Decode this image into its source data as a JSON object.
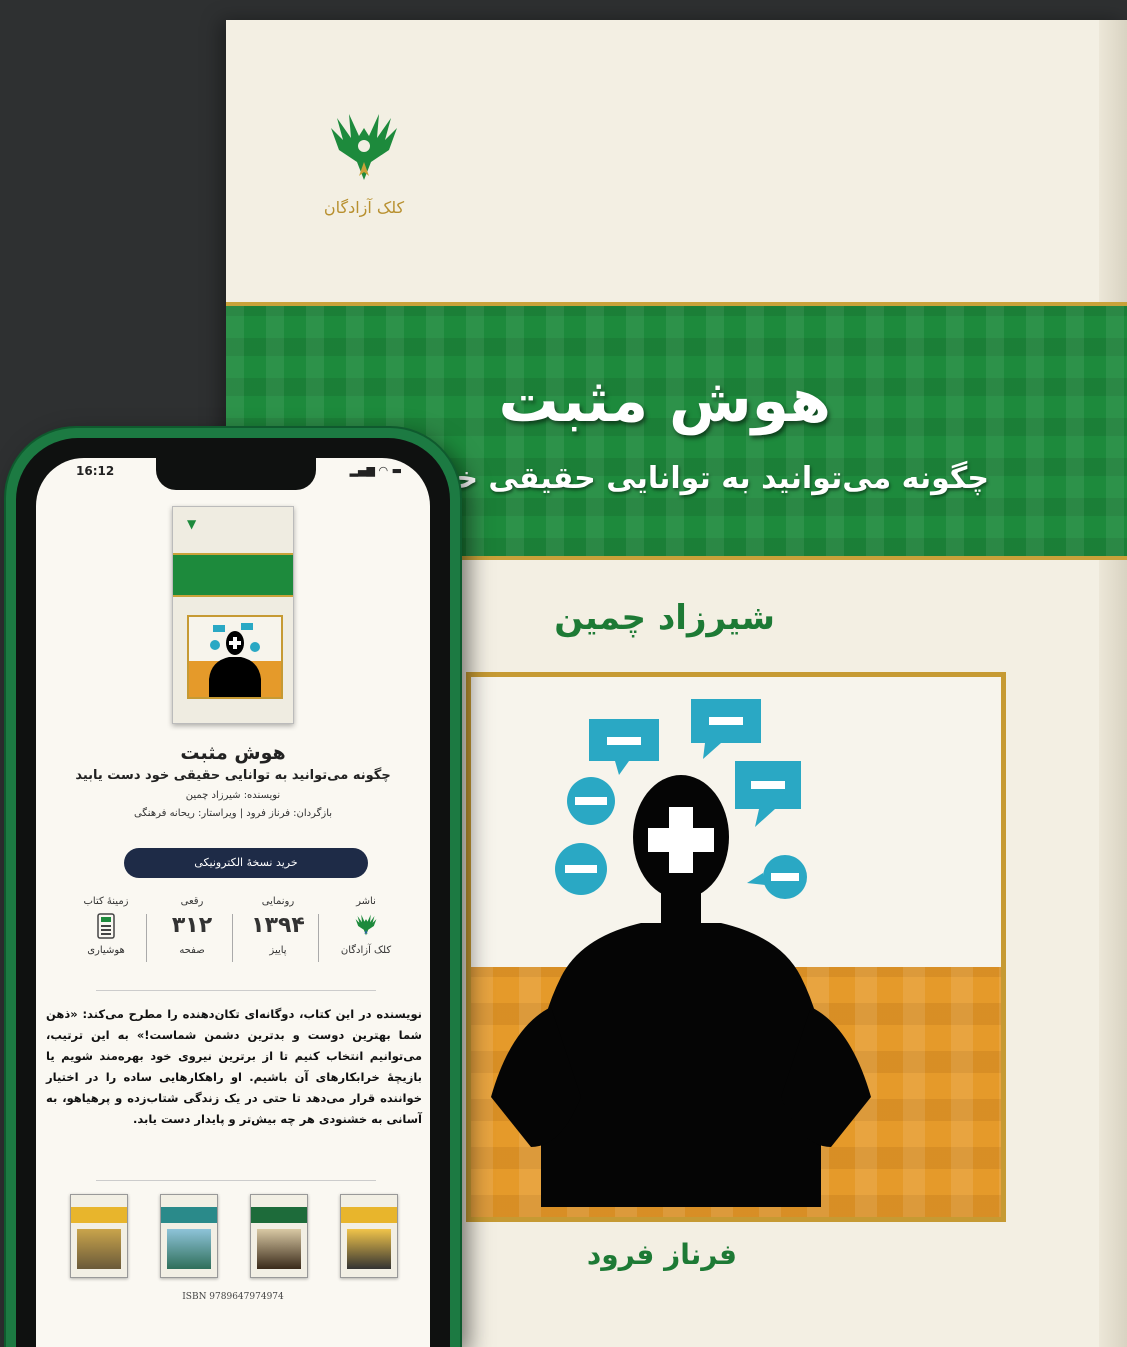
{
  "cover": {
    "publisher": "کلک آزادگان",
    "title": "هوش مثبت",
    "subtitle": "چگونه می‌توانید به توانایی حقیقی خود دست",
    "author": "شیرزاد چمین",
    "translator": "فرناز فرود"
  },
  "phone": {
    "time": "16:12",
    "book_title": "هوش مثبت",
    "book_subtitle": "چگونه می‌توانید به توانایی حقیقی خود دست یابید",
    "author_line": "نویسنده: شیرزاد چمین",
    "credits_line": "بازگردان: فرناز فرود | ویراستار: ریحانه فرهنگی",
    "buy_button": "خرید نسخهٔ الکترونیکی",
    "info": [
      {
        "label": "ناشر",
        "value": "",
        "foot": "کلک آزادگان",
        "icon": "publisher-logo-icon"
      },
      {
        "label": "رونمایی",
        "value": "۱۳۹۴",
        "foot": "پاییز"
      },
      {
        "label": "رقعی",
        "value": "۳۱۲",
        "foot": "صفحه"
      },
      {
        "label": "زمینهٔ کتاب",
        "value": "",
        "foot": "هوشیاری",
        "icon": "calculator-icon"
      }
    ],
    "description": "نویسنده در این کتاب، دوگانه‌ای تکان‌دهنده را مطرح می‌کند: «ذهن شما بهترین دوست و بدترین دشمن شماست!» به این ترتیب، می‌توانیم انتخاب کنیم تا از برترین نیروی خود بهره‌مند شویم یا بازیچهٔ خرابکارهای آن باشیم. او راهکارهایی ساده را در اختیار خواننده قرار می‌دهد تا حتی در یک زندگی شتاب‌زده و پرهیاهو، به آسانی به خشنودی هر چه بیش‌تر و پایدار دست یابد.",
    "isbn": "ISBN 9789647974974"
  },
  "colors": {
    "green": "#1d8a3c",
    "gold": "#c9a23a",
    "orange": "#e59a2a",
    "button": "#1e2b47",
    "speech": "#2aa8c4"
  }
}
